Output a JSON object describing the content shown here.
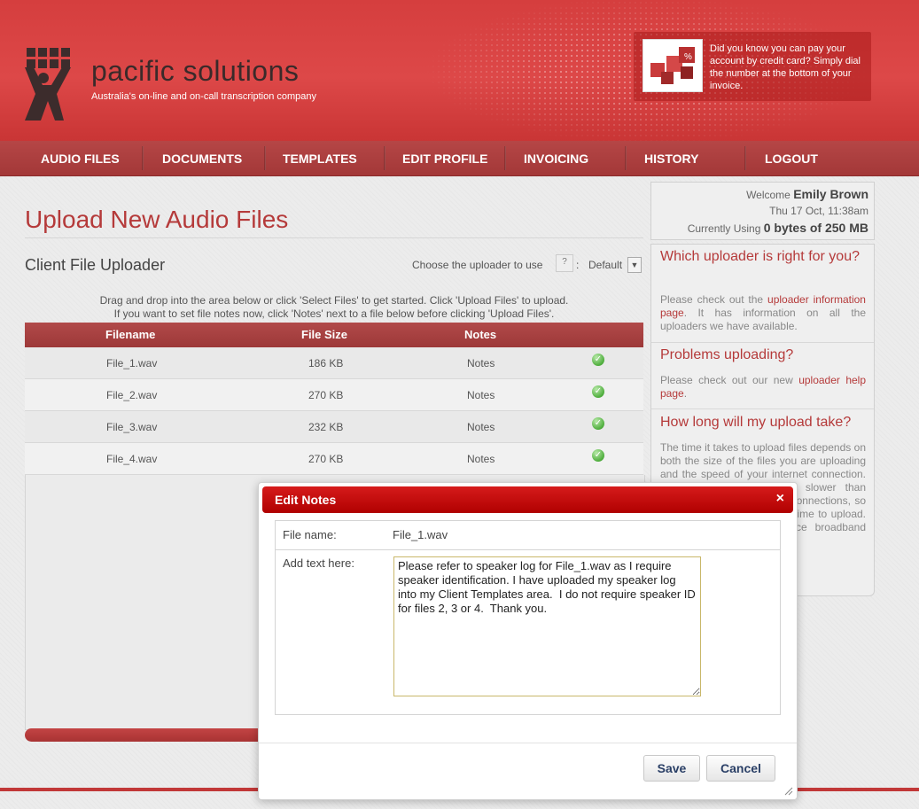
{
  "brand": {
    "name": "pacific solutions",
    "tagline": "Australia's on-line and on-call transcription company"
  },
  "promo": {
    "text": "Did you know you can pay your account by credit card? Simply dial the number at the bottom of your invoice."
  },
  "nav": {
    "items": [
      "AUDIO FILES",
      "DOCUMENTS",
      "TEMPLATES",
      "EDIT PROFILE",
      "INVOICING",
      "HISTORY",
      "LOGOUT"
    ]
  },
  "main": {
    "page_title": "Upload New Audio Files",
    "section_title": "Client File Uploader",
    "uploader_label": "Choose the uploader to use",
    "help_label": "?",
    "colon": ":",
    "uploader_value": "Default",
    "instructions_line1": "Drag and drop into the area below or click 'Select Files' to get started. Click 'Upload Files' to upload.",
    "instructions_line2": "If you want to set file notes now, click 'Notes' next to a file below before clicking 'Upload Files'.",
    "table": {
      "headers": [
        "Filename",
        "File Size",
        "Notes"
      ],
      "rows": [
        {
          "filename": "File_1.wav",
          "size": "186 KB",
          "notes": "Notes"
        },
        {
          "filename": "File_2.wav",
          "size": "270 KB",
          "notes": "Notes"
        },
        {
          "filename": "File_3.wav",
          "size": "232 KB",
          "notes": "Notes"
        },
        {
          "filename": "File_4.wav",
          "size": "270 KB",
          "notes": "Notes"
        }
      ]
    }
  },
  "sidebar": {
    "welcome_prefix": "Welcome",
    "user_name": "Emily Brown",
    "datetime": "Thu 17 Oct, 11:38am",
    "usage_prefix": "Currently Using",
    "usage_value": "0 bytes of 250 MB",
    "faq": [
      {
        "question": "Which uploader is right for you?",
        "answer_pre": "Please check out the ",
        "link": "uploader information page",
        "answer_post": ". It has information on all the uploaders we have available."
      },
      {
        "question": "Problems uploading?",
        "answer_pre": "Please check out our new ",
        "link": "uploader help page",
        "answer_post": "."
      },
      {
        "question": "How long will my upload take?",
        "answer_pre": "The time it takes to upload files depends on both the size of the files you are uploading and the speed of your internet connection. Upload speeds are a lot slower than download speeds for most connections, so a 50MB file can take some time to upload.",
        "link": "",
        "answer_post": " Uploading from a workplace broadband connection may be faster."
      }
    ]
  },
  "modal": {
    "title": "Edit Notes",
    "close": "×",
    "file_label": "File name:",
    "file_value": "File_1.wav",
    "text_label": "Add text here:",
    "notes_text": "Please refer to speaker log for File_1.wav as I require speaker identification. I have uploaded my speaker log into my Client Templates area.  I do not require speaker ID for files 2, 3 or 4.  Thank you. ",
    "save_label": "Save",
    "cancel_label": "Cancel"
  },
  "colors": {
    "brand_red": "#d53e3e",
    "nav_red": "#a33838",
    "title_red": "#b53a3a",
    "modal_red": "#c00000",
    "ok_green": "#4fae3d"
  }
}
